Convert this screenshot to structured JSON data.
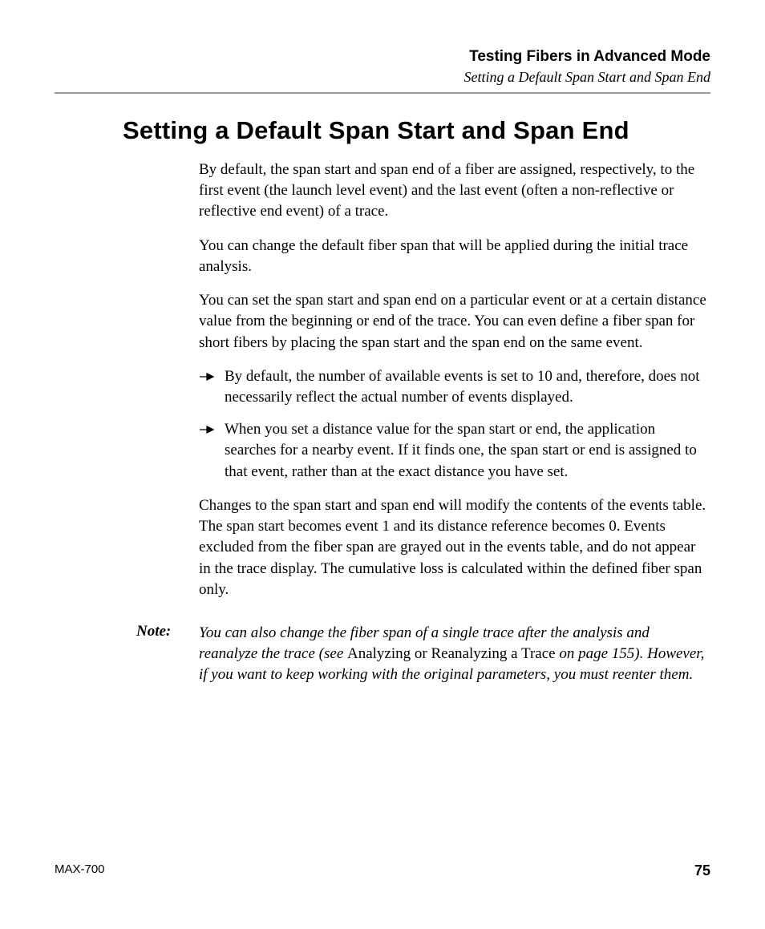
{
  "header": {
    "chapter": "Testing Fibers in Advanced Mode",
    "section": "Setting a Default Span Start and Span End"
  },
  "title": "Setting a Default Span Start and Span End",
  "paragraphs": {
    "p1": "By default, the span start and span end of a fiber are assigned, respectively, to the first event (the launch level event) and the last event (often a non-reflective or reflective end event) of a trace.",
    "p2": "You can change the default fiber span that will be applied during the initial trace analysis.",
    "p3": "You can set the span start and span end on a particular event or at a certain distance value from the beginning or end of the trace. You can even define a fiber span for short fibers by placing the span start and the span end on the same event.",
    "p4": "Changes to the span start and span end will modify the contents of the events table. The span start becomes event 1 and its distance reference becomes 0. Events excluded from the fiber span are grayed out in the events table, and do not appear in the trace display. The cumulative loss is calculated within the defined fiber span only."
  },
  "bullets": [
    "By default, the number of available events is set to 10 and, therefore, does not necessarily reflect the actual number of events displayed.",
    "When you set a distance value for the span start or end, the application searches for a nearby event. If it finds one, the span start or end is assigned to that event, rather than at the exact distance you have set."
  ],
  "note": {
    "label": "Note:",
    "pre": "You can also change the fiber span of a single trace after the analysis and reanalyze the trace (see ",
    "link": "Analyzing or Reanalyzing a Trace",
    "post": " on page 155). However, if you want to keep working with the original parameters, you must reenter them."
  },
  "footer": {
    "product": "MAX-700",
    "page": "75"
  }
}
